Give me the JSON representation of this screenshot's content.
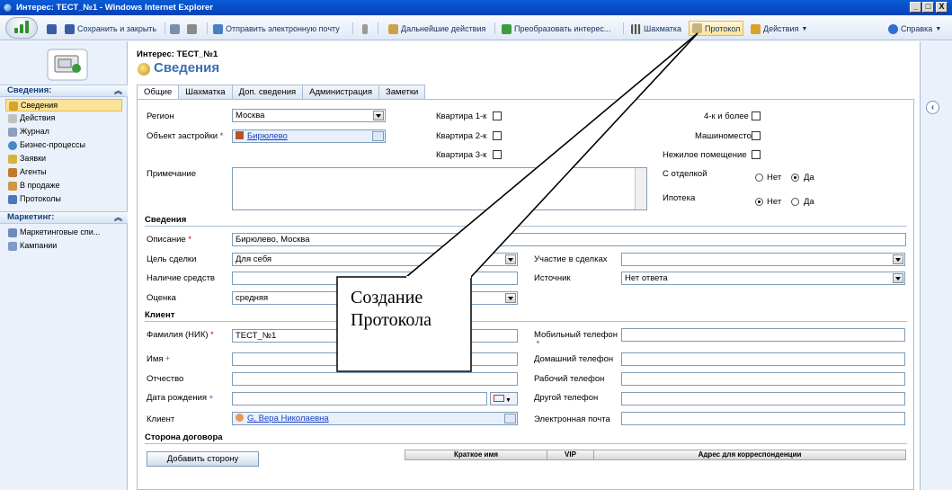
{
  "window": {
    "title": "Интерес: ТЕСТ_№1 - Windows Internet Explorer",
    "min": "_",
    "max": "□",
    "close": "X"
  },
  "toolbar": {
    "save_close": "Сохранить и закрыть",
    "send_email": "Отправить электронную почту",
    "next_actions": "Дальнейшие действия",
    "convert": "Преобразовать интерес...",
    "chessboard": "Шахматка",
    "protocol": "Протокол",
    "actions": "Действия",
    "help": "Справка"
  },
  "nav": {
    "section1": "Сведения:",
    "items1": [
      "Сведения",
      "Действия",
      "Журнал",
      "Бизнес-процессы",
      "Заявки",
      "Агенты",
      "В продаже",
      "Протоколы"
    ],
    "section2": "Маркетинг:",
    "items2": [
      "Маркетинговые спи...",
      "Кампании"
    ],
    "collapse": "«"
  },
  "record": {
    "label": "Интерес: ТЕСТ_№1",
    "title": "Сведения"
  },
  "tabs": [
    "Общие",
    "Шахматка",
    "Доп. сведения",
    "Администрация",
    "Заметки"
  ],
  "form": {
    "region_label": "Регион",
    "region_value": "Москва",
    "object_label": "Объект застройки",
    "object_value": "Бирюлево",
    "note_label": "Примечание",
    "apt1": "Квартира 1-к",
    "apt2": "Квартира 2-к",
    "apt3": "Квартира 3-к",
    "apt4": "4-к и более",
    "parking": "Машиноместо",
    "nonres": "Нежилое помещение",
    "finishing": "С отделкой",
    "mortgage": "Ипотека",
    "no": "Нет",
    "yes": "Да",
    "sec_info": "Сведения",
    "desc_label": "Описание",
    "desc_value": "Бирюлево, Москва",
    "goal_label": "Цель сделки",
    "goal_value": "Для себя",
    "funds_label": "Наличие средств",
    "rating_label": "Оценка",
    "rating_value": "средняя",
    "deals_label": "Участие в сделках",
    "source_label": "Источник",
    "source_value": "Нет ответа",
    "sec_client": "Клиент",
    "lastname_label": "Фамилия (НИК)",
    "lastname_value": "ТЕСТ_№1",
    "firstname_label": "Имя",
    "middlename_label": "Отчество",
    "birth_label": "Дата рождения",
    "client_label": "Клиент",
    "client_value": "G, Вера Николаевна",
    "mobile_label": "Мобильный телефон",
    "home_label": "Домашний телефон",
    "work_label": "Рабочий телефон",
    "other_label": "Другой телефон",
    "email_label": "Электронная почта",
    "sec_party": "Сторона договора",
    "add_party": "Добавить сторону",
    "grid_cols": [
      "Краткое имя",
      "VIP",
      "Адрес для корреспонденции"
    ]
  },
  "callout": {
    "line1": "Создание",
    "line2": "Протокола"
  }
}
